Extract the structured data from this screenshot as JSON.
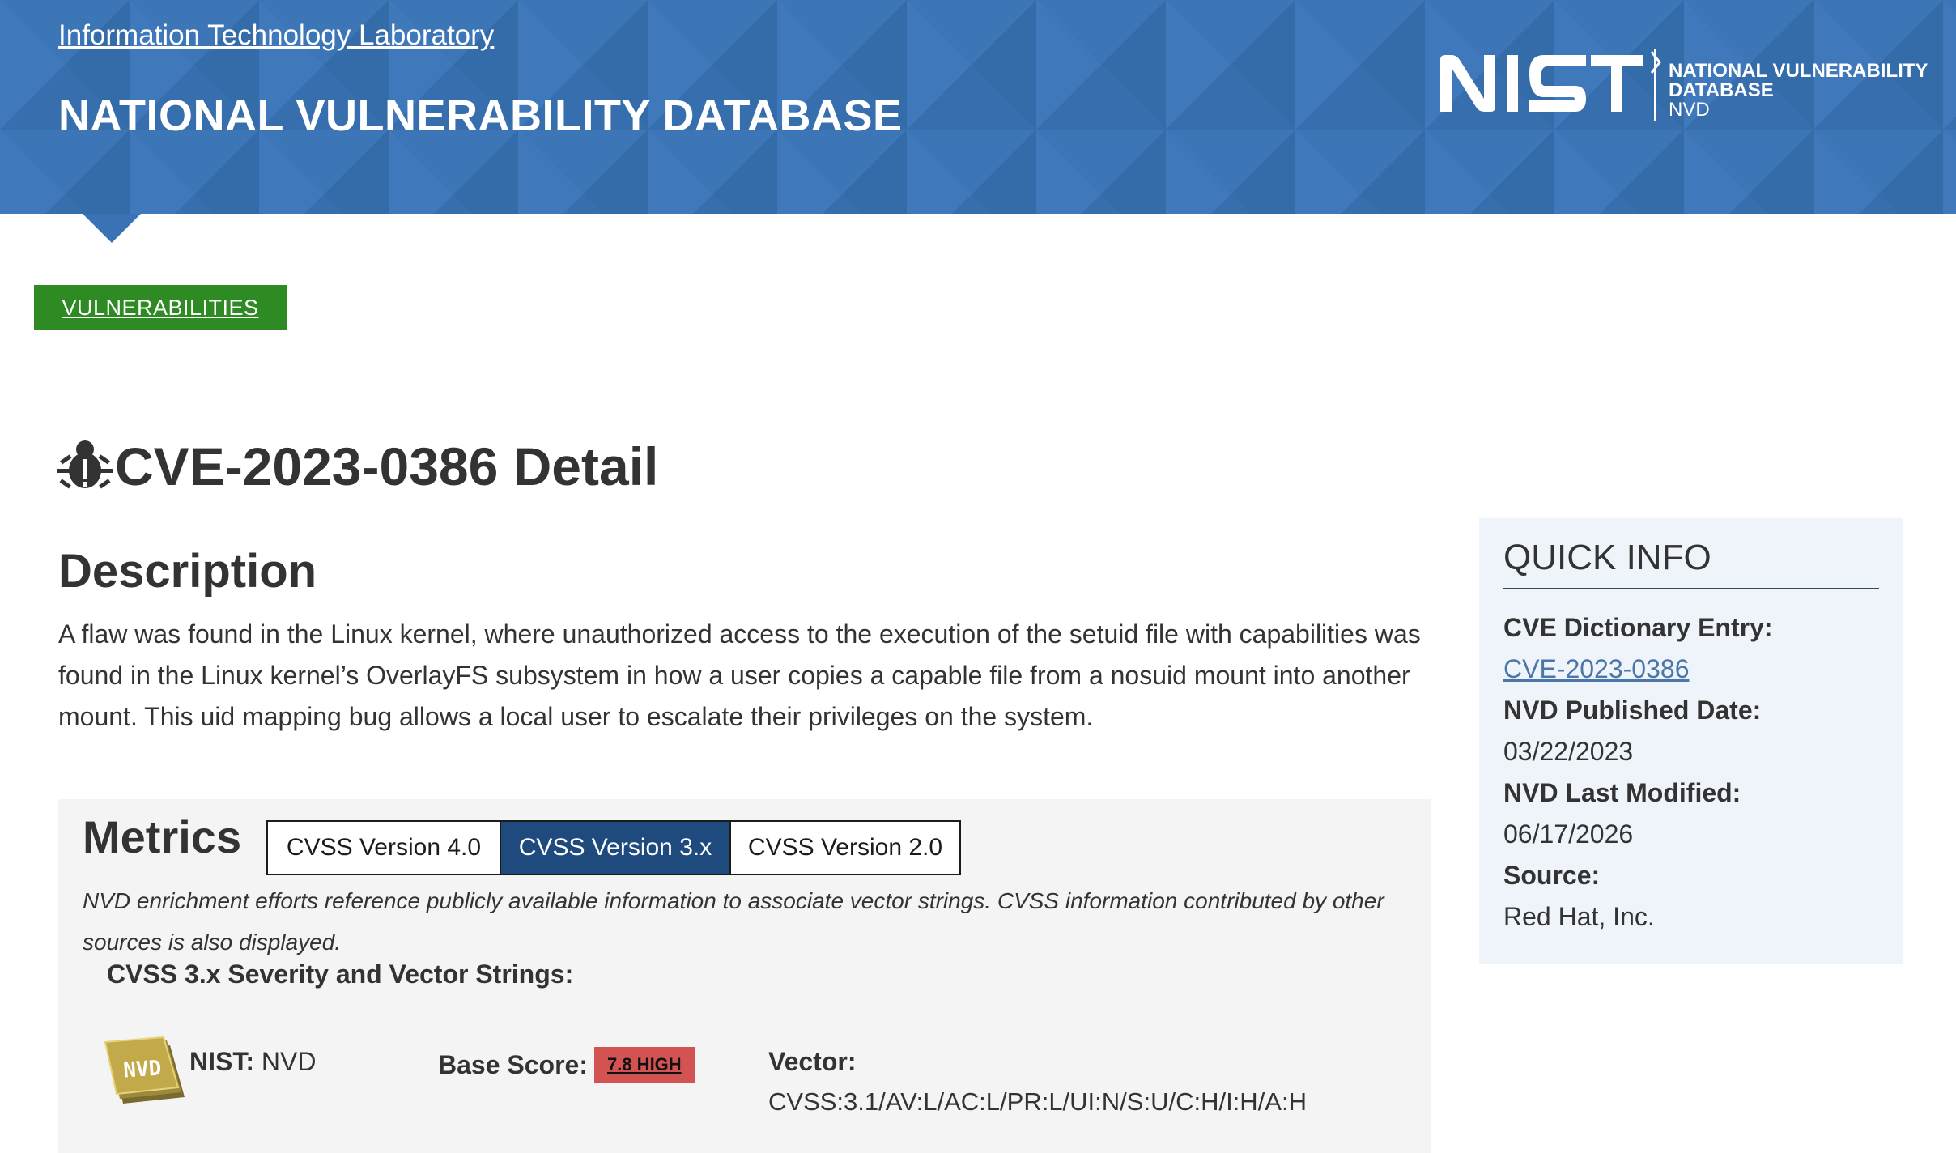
{
  "header": {
    "itl_link": "Information Technology Laboratory",
    "title": "NATIONAL VULNERABILITY DATABASE",
    "logo": {
      "wordmark": "NIST",
      "line1": "NATIONAL VULNERABILITY",
      "line2": "DATABASE",
      "line3": "NVD"
    },
    "background_color": "#3a73b5"
  },
  "breadcrumb": {
    "label": "VULNERABILITIES",
    "background_color": "#2e8b24"
  },
  "page": {
    "title": "CVE-2023-0386 Detail",
    "title_icon": "bug-icon"
  },
  "description": {
    "heading": "Description",
    "text": "A flaw was found in the Linux kernel, where unauthorized access to the execution of the setuid file with capabilities was found in the Linux kernel’s OverlayFS subsystem in how a user copies a capable file from a nosuid mount into another mount. This uid mapping bug allows a local user to escalate their privileges on the system."
  },
  "metrics": {
    "heading": "Metrics",
    "tabs": [
      {
        "label": "CVSS Version 4.0",
        "selected": false
      },
      {
        "label": "CVSS Version 3.x",
        "selected": true
      },
      {
        "label": "CVSS Version 2.0",
        "selected": false
      }
    ],
    "note": "NVD enrichment efforts reference publicly available information to associate vector strings. CVSS information contributed by other sources is also displayed.",
    "severity_heading": "CVSS 3.x Severity and Vector Strings:",
    "source_label": "NIST:",
    "source_value": "NVD",
    "badge_icon": "nvd-badge-icon",
    "base_score_label": "Base Score:",
    "base_score_value": "7.8 HIGH",
    "base_score_color": "#d35353",
    "vector_label": "Vector:",
    "vector_value": "CVSS:3.1/AV:L/AC:L/PR:L/UI:N/S:U/C:H/I:H/A:H",
    "selected_tab_color": "#1f4a7e"
  },
  "quick_info": {
    "title": "QUICK INFO",
    "cve_entry_label": "CVE Dictionary Entry:",
    "cve_entry_value": "CVE-2023-0386",
    "published_label": "NVD Published Date:",
    "published_value": "03/22/2023",
    "modified_label": "NVD Last Modified:",
    "modified_value": "06/17/2026",
    "source_label": "Source:",
    "source_value": "Red Hat, Inc."
  }
}
